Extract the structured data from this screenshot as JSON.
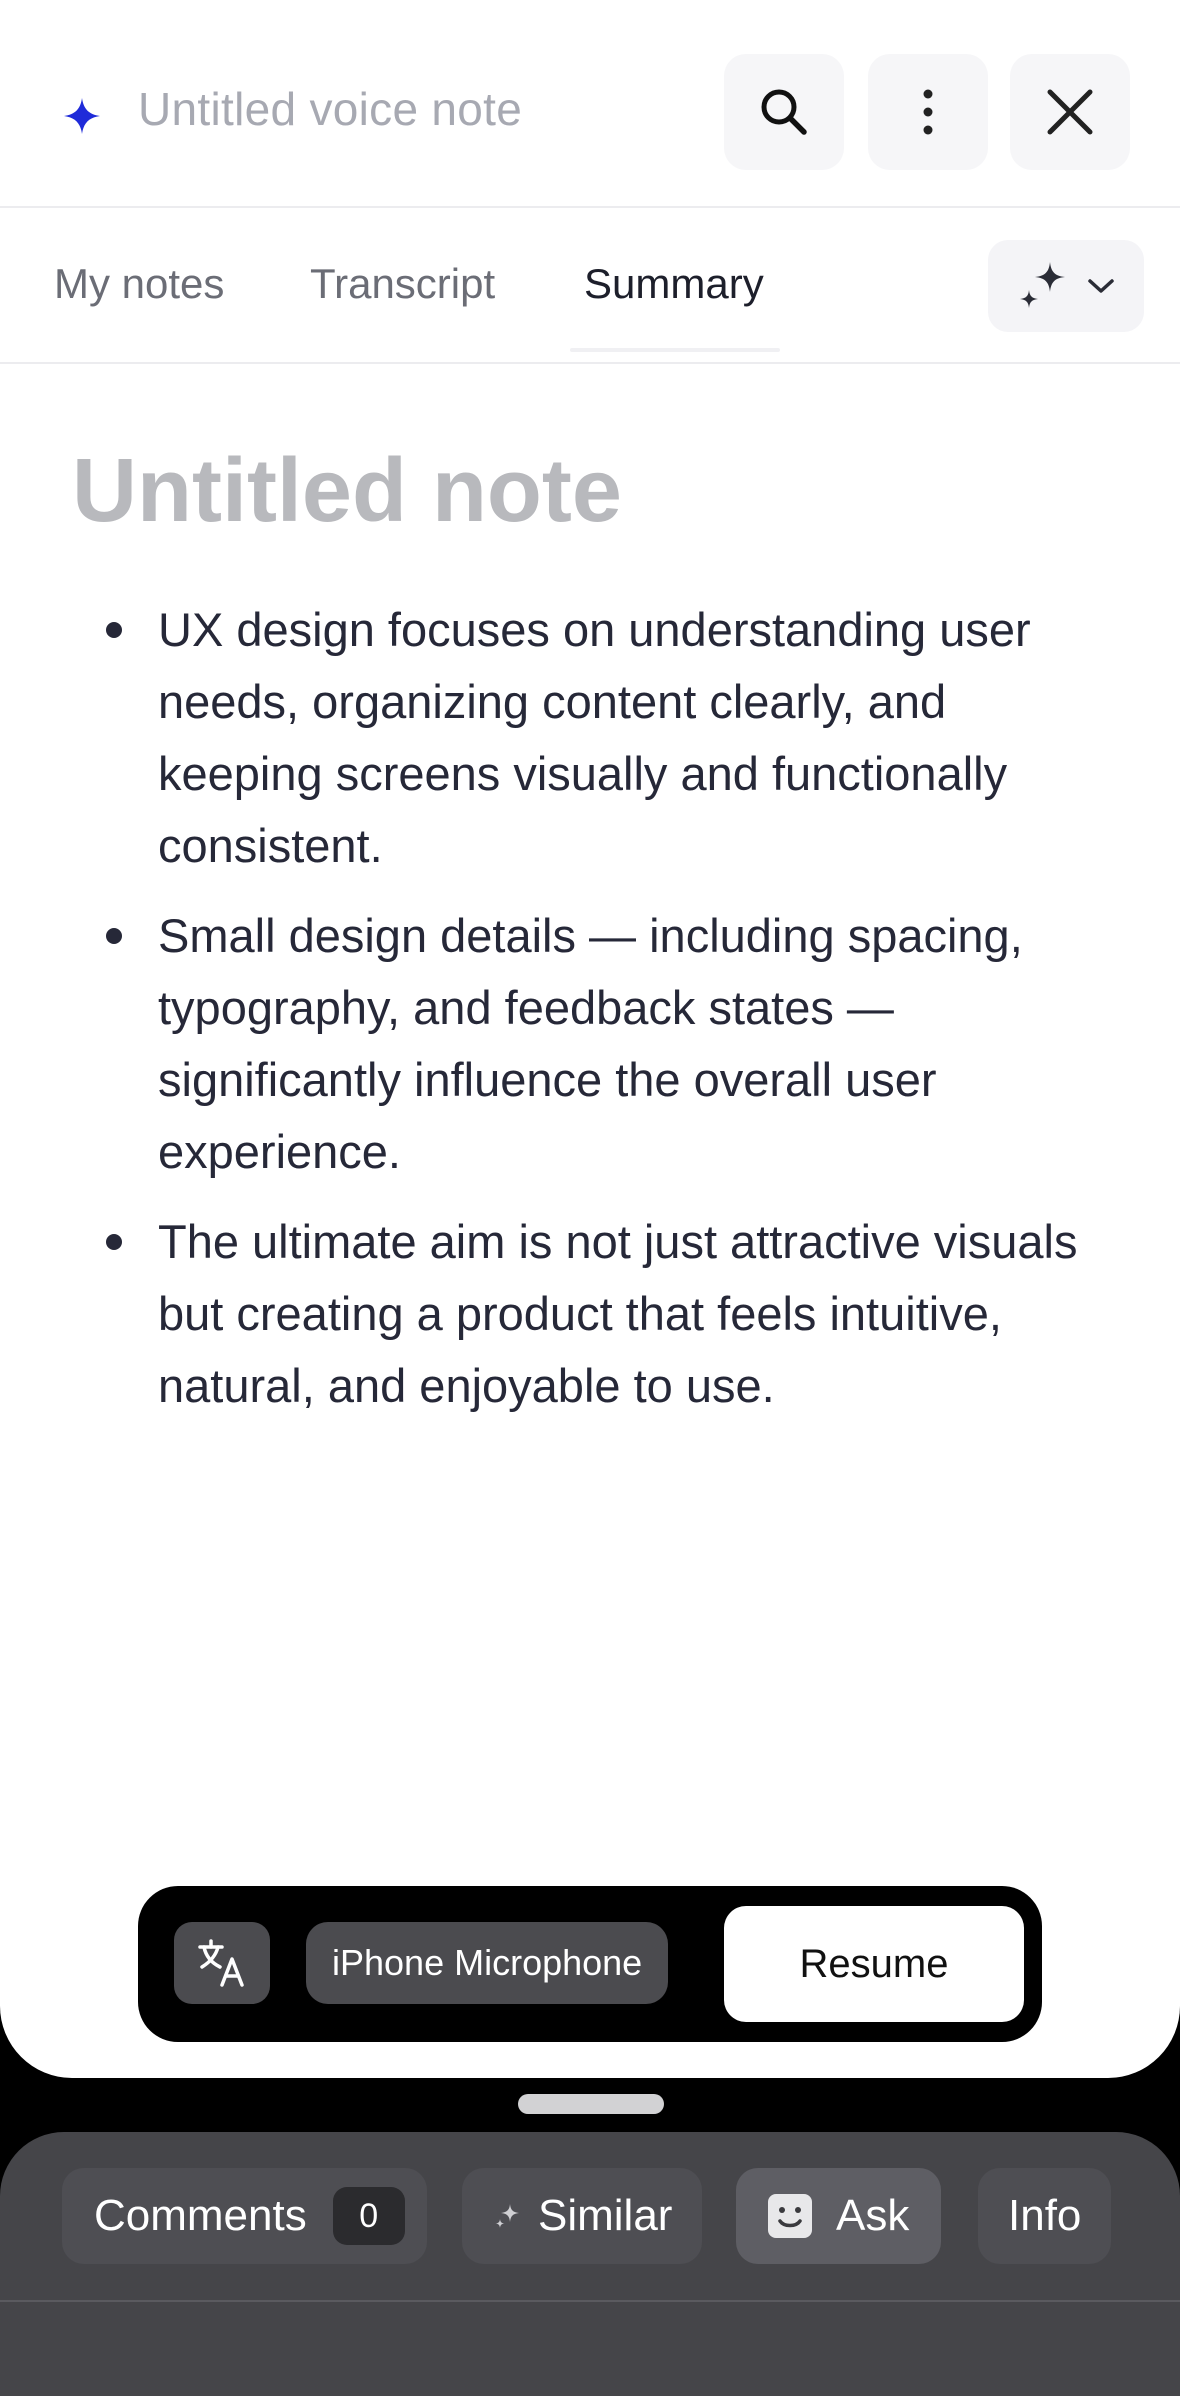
{
  "header": {
    "title_placeholder": "Untitled voice note",
    "accent_color": "#1f2bd9"
  },
  "tabs": [
    {
      "label": "My notes",
      "active": false
    },
    {
      "label": "Transcript",
      "active": false
    },
    {
      "label": "Summary",
      "active": true
    }
  ],
  "note": {
    "title": "Untitled note",
    "bullets": [
      "UX design focuses on understanding user needs, organizing content clearly, and keeping screens visually and functionally consistent.",
      "Small design details — including spacing, typography, and feedback states — significantly influence the overall user experience.",
      "The ultimate aim is not just attractive visuals but creating a product that feels intuitive, natural, and enjoyable to use."
    ]
  },
  "recorder": {
    "input_device": "iPhone Microphone",
    "resume_label": "Resume"
  },
  "bottom_bar": {
    "comments_label": "Comments",
    "comments_count": "0",
    "similar_label": "Similar",
    "ask_label": "Ask",
    "info_label": "Info"
  },
  "icons": [
    "sparkle-icon",
    "search-icon",
    "more-vertical-icon",
    "close-icon",
    "ai-sparkles-icon",
    "chevron-down-icon",
    "translate-icon",
    "small-sparkle-icon",
    "smiley-icon"
  ]
}
